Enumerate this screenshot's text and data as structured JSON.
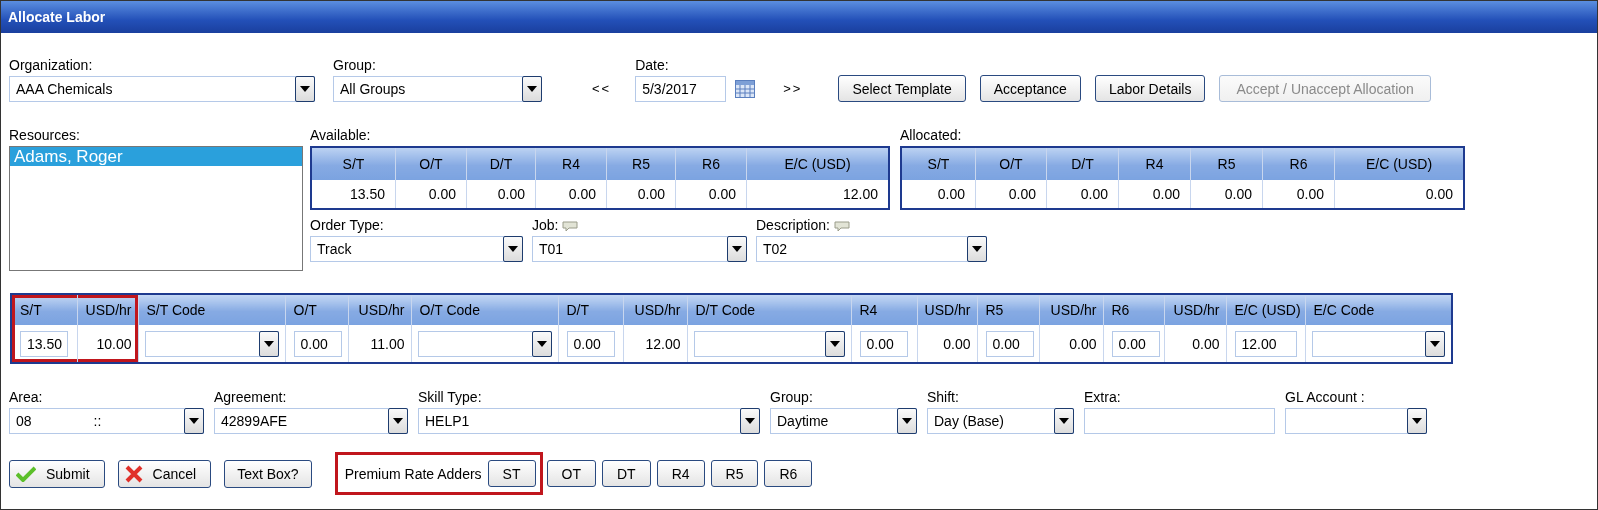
{
  "window": {
    "title": "Allocate Labor"
  },
  "organization": {
    "label": "Organization:",
    "value": "AAA Chemicals"
  },
  "group": {
    "label": "Group:",
    "value": "All Groups"
  },
  "date": {
    "label": "Date:",
    "value": "5/3/2017",
    "prev": "<<",
    "next": ">>"
  },
  "actions": [
    {
      "label": "Select Template",
      "disabled": false
    },
    {
      "label": "Acceptance",
      "disabled": false
    },
    {
      "label": "Labor Details",
      "disabled": false
    },
    {
      "label": "Accept / Unaccept Allocation",
      "disabled": true
    }
  ],
  "resources": {
    "label": "Resources:",
    "items": [
      {
        "name": "Adams, Roger",
        "selected": true
      }
    ]
  },
  "available": {
    "label": "Available:",
    "columns": [
      "S/T",
      "O/T",
      "D/T",
      "R4",
      "R5",
      "R6",
      "E/C (USD)"
    ],
    "values": [
      "13.50",
      "0.00",
      "0.00",
      "0.00",
      "0.00",
      "0.00",
      "12.00"
    ]
  },
  "allocated": {
    "label": "Allocated:",
    "columns": [
      "S/T",
      "O/T",
      "D/T",
      "R4",
      "R5",
      "R6",
      "E/C (USD)"
    ],
    "values": [
      "0.00",
      "0.00",
      "0.00",
      "0.00",
      "0.00",
      "0.00",
      "0.00"
    ]
  },
  "order_fields": [
    {
      "label": "Order Type:",
      "value": "Track",
      "note": false
    },
    {
      "label": "Job:",
      "value": "T01",
      "note": true
    },
    {
      "label": "Description:",
      "value": "T02",
      "note": true
    }
  ],
  "grid": {
    "columns": [
      {
        "label": "S/T",
        "kind": "input",
        "highlighted": true,
        "value": "13.50"
      },
      {
        "label": "USD/hr",
        "kind": "text",
        "highlighted": true,
        "value": "10.00"
      },
      {
        "label": "S/T Code",
        "kind": "select",
        "highlighted": false
      },
      {
        "label": "O/T",
        "kind": "input",
        "highlighted": false,
        "value": "0.00"
      },
      {
        "label": "USD/hr",
        "kind": "text",
        "highlighted": false,
        "value": "11.00"
      },
      {
        "label": "O/T Code",
        "kind": "select",
        "highlighted": false
      },
      {
        "label": "D/T",
        "kind": "input",
        "highlighted": false,
        "value": "0.00"
      },
      {
        "label": "USD/hr",
        "kind": "text",
        "highlighted": false,
        "value": "12.00"
      },
      {
        "label": "D/T Code",
        "kind": "select",
        "highlighted": false
      },
      {
        "label": "R4",
        "kind": "input",
        "highlighted": false,
        "value": "0.00"
      },
      {
        "label": "USD/hr",
        "kind": "text",
        "highlighted": false,
        "value": "0.00"
      },
      {
        "label": "R5",
        "kind": "input",
        "highlighted": false,
        "value": "0.00"
      },
      {
        "label": "USD/hr",
        "kind": "text",
        "highlighted": false,
        "value": "0.00"
      },
      {
        "label": "R6",
        "kind": "input",
        "highlighted": false,
        "value": "0.00"
      },
      {
        "label": "USD/hr",
        "kind": "text",
        "highlighted": false,
        "value": "0.00"
      },
      {
        "label": "E/C (USD)",
        "kind": "input",
        "highlighted": false,
        "value": "12.00"
      },
      {
        "label": "E/C Code",
        "kind": "select",
        "highlighted": false
      }
    ]
  },
  "detail_fields": [
    {
      "label": "Area:",
      "kind": "select",
      "value": "08",
      "code": "::"
    },
    {
      "label": "Agreement:",
      "kind": "select",
      "value": "42899AFE"
    },
    {
      "label": "Skill Type:",
      "kind": "select",
      "value": "HELP1"
    },
    {
      "label": "Group:",
      "kind": "select",
      "value": "Daytime"
    },
    {
      "label": "Shift:",
      "kind": "select",
      "value": "Day (Base)"
    },
    {
      "label": "Extra:",
      "kind": "text"
    },
    {
      "label": "GL Account :",
      "kind": "select"
    }
  ],
  "form_buttons": [
    {
      "label": "Submit",
      "kind": "confirm"
    },
    {
      "label": "Cancel",
      "kind": "cancel"
    },
    {
      "label": "Text Box?",
      "kind": "plain"
    }
  ],
  "premium": {
    "label": "Premium Rate Adders",
    "highlighted": true,
    "boxed_buttons": [
      "ST"
    ],
    "buttons": [
      "OT",
      "DT",
      "R4",
      "R5",
      "R6"
    ]
  }
}
